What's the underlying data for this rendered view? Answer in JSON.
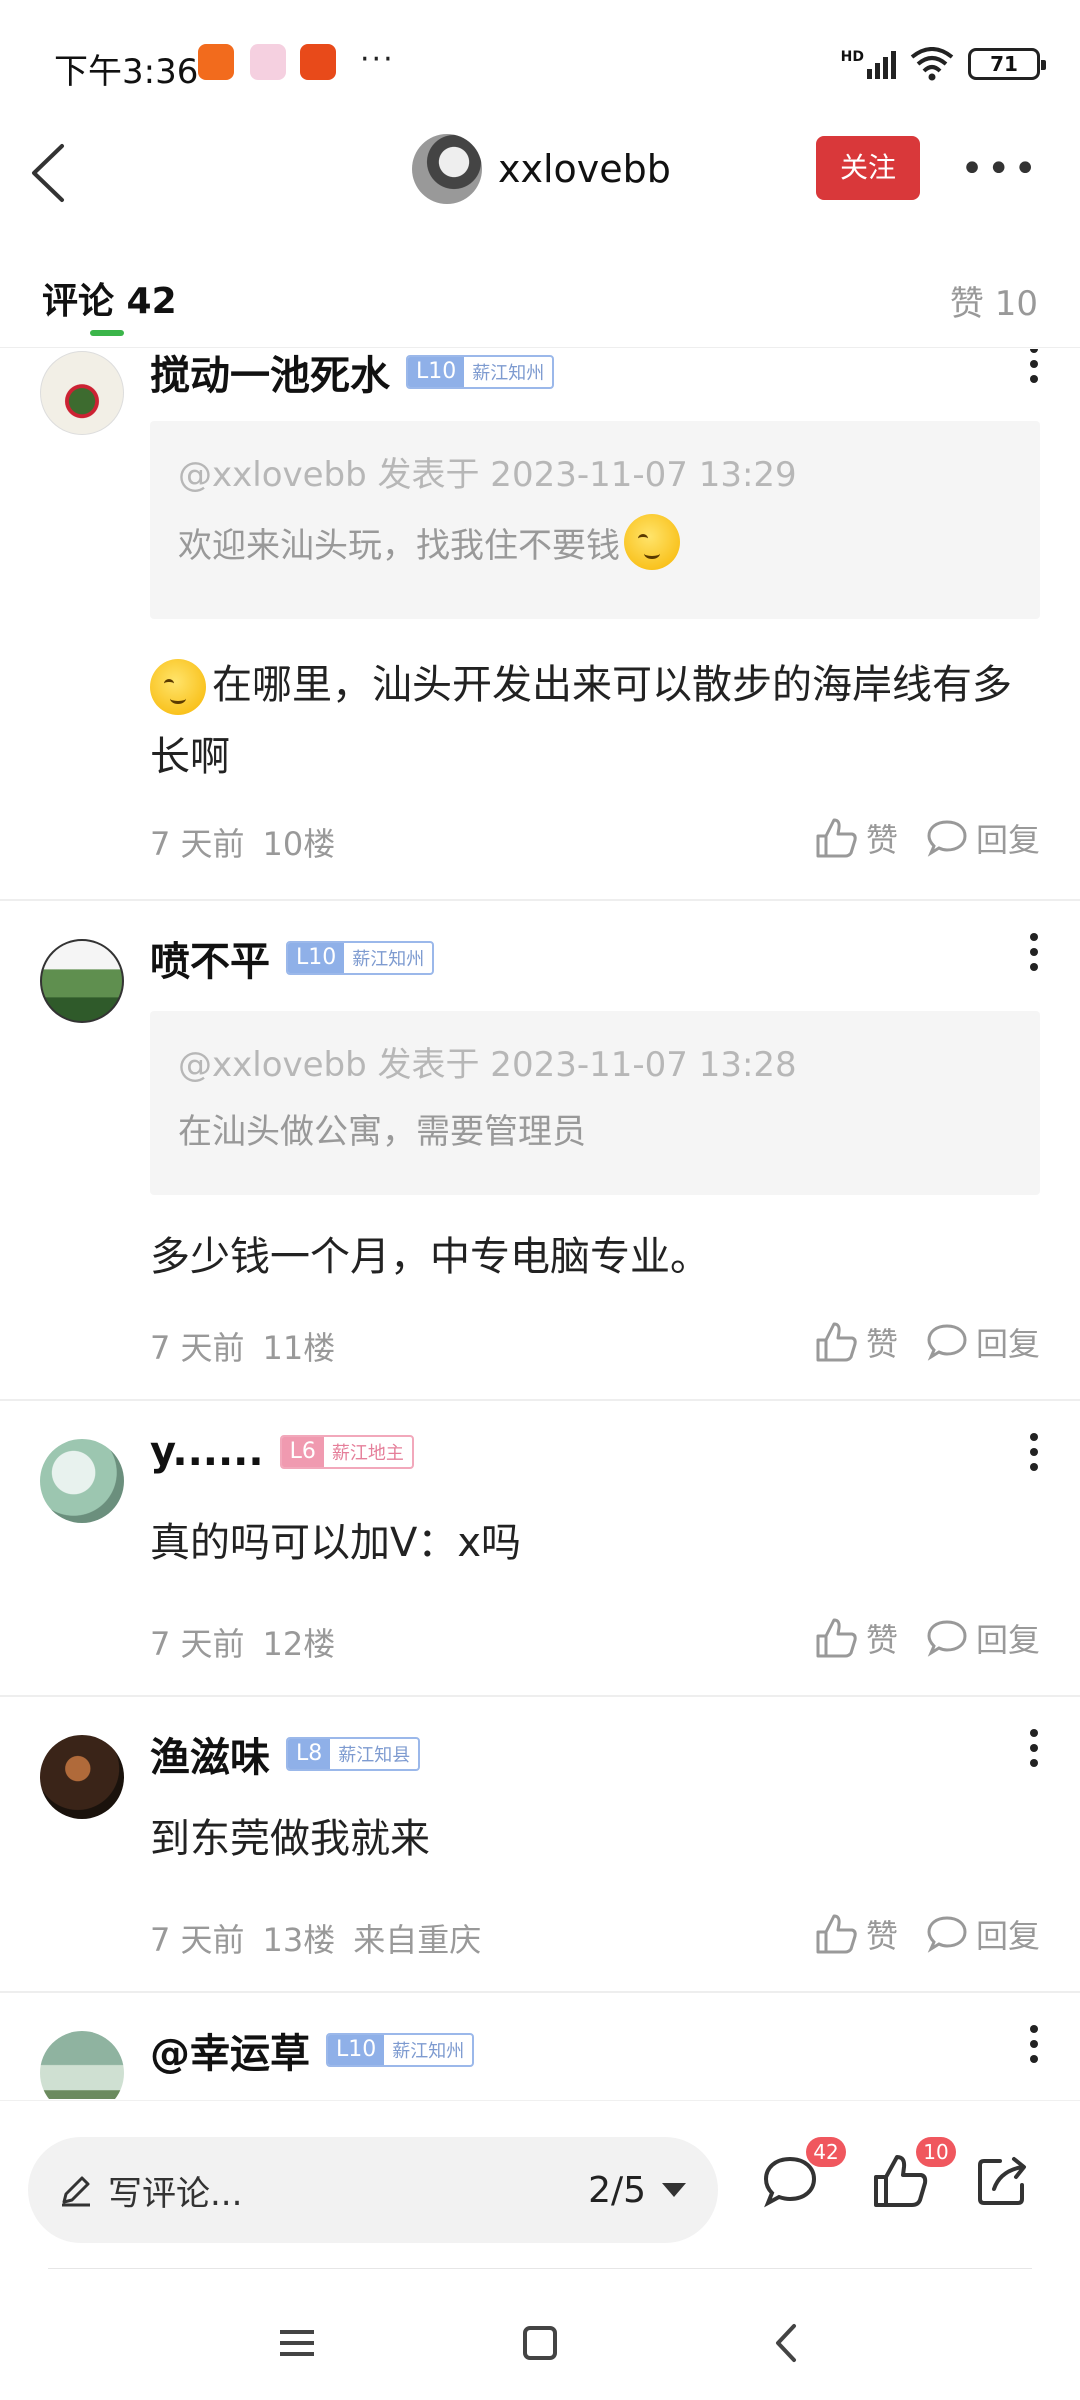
{
  "status_bar": {
    "time": "下午3:36",
    "signal": "HD",
    "battery": "71"
  },
  "header": {
    "author_name": "xxlovebb",
    "follow_label": "关注"
  },
  "tabs": {
    "comments_label": "评论 42",
    "likes_label": "赞 10"
  },
  "comments": [
    {
      "name": "搅动一池死水",
      "level": "L10",
      "title": "薪江知州",
      "quote_meta": "@xxlovebb 发表于 2023-11-07 13:29",
      "quote_text": "欢迎来汕头玩，找我住不要钱",
      "body": "在哪里，汕头开发出来可以散步的海岸线有多长啊",
      "time": "7 天前",
      "floor": "10楼",
      "like_label": "赞",
      "reply_label": "回复"
    },
    {
      "name": "喷不平",
      "level": "L10",
      "title": "薪江知州",
      "quote_meta": "@xxlovebb 发表于 2023-11-07 13:28",
      "quote_text": "在汕头做公寓，需要管理员",
      "body": "多少钱一个月，中专电脑专业。",
      "time": "7 天前",
      "floor": "11楼",
      "like_label": "赞",
      "reply_label": "回复"
    },
    {
      "name": "y......",
      "level": "L6",
      "title": "薪江地主",
      "body": "真的吗可以加V：x吗",
      "time": "7 天前",
      "floor": "12楼",
      "like_label": "赞",
      "reply_label": "回复"
    },
    {
      "name": "渔滋味",
      "level": "L8",
      "title": "薪江知县",
      "body": "到东莞做我就来",
      "time": "7 天前",
      "floor": "13楼",
      "location": "来自重庆",
      "like_label": "赞",
      "reply_label": "回复"
    },
    {
      "name": "@幸运草",
      "level": "L10",
      "title": "薪江知州"
    }
  ],
  "bottom_bar": {
    "input_placeholder": "写评论...",
    "page_indicator": "2/5",
    "comment_count": "42",
    "like_count": "10"
  },
  "colors": {
    "follow_red": "#d9383a",
    "tab_indicator_green": "#3bb54a",
    "badge_blue": "#8fb0e8",
    "badge_pink": "#f09ab0"
  }
}
